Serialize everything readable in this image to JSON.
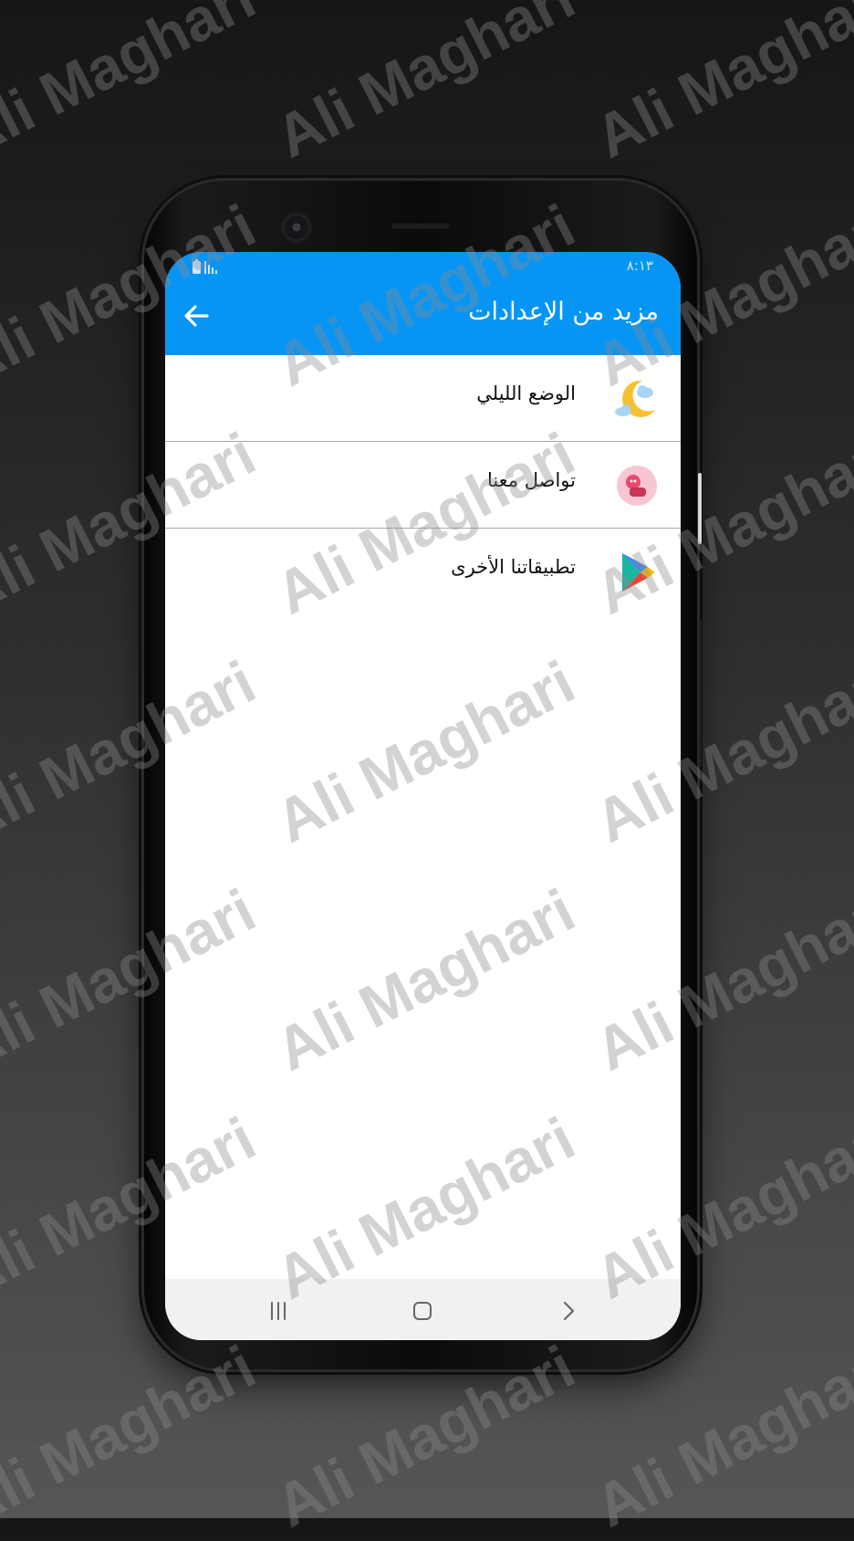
{
  "status_bar": {
    "time": "٨:١٣"
  },
  "app_bar": {
    "title": "مزيد من الإعدادات",
    "back_icon": "arrow-left-icon"
  },
  "menu": {
    "items": [
      {
        "label": "الوضع الليلي",
        "icon": "moon-cloud-icon"
      },
      {
        "label": "تواصل معنا",
        "icon": "contact-chat-icon"
      },
      {
        "label": "تطبيقاتنا الأخرى",
        "icon": "play-store-icon"
      }
    ]
  },
  "nav_bar": {
    "recents_icon": "recents-icon",
    "home_icon": "home-icon",
    "back_icon": "chevron-right-icon"
  },
  "watermark": {
    "text": "Ali Maghari"
  },
  "colors": {
    "app_bar": "#0695f5",
    "background_top": "#151617",
    "background_bottom": "#555657",
    "nav_bar": "#f3f0f3"
  }
}
